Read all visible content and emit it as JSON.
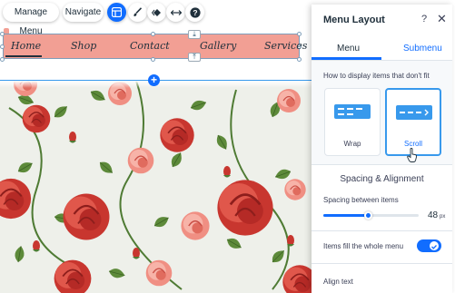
{
  "toolbar": {
    "manage_menu": "Manage Menu",
    "navigate": "Navigate",
    "icons": [
      "layout-icon",
      "paint-brush-icon",
      "animation-icon",
      "stretch-icon",
      "help-icon"
    ]
  },
  "site_menu": {
    "items": [
      {
        "label": "Home",
        "active": true
      },
      {
        "label": "Shop"
      },
      {
        "label": "Contact"
      },
      {
        "label": "Gallery"
      },
      {
        "label": "Services"
      }
    ],
    "background_color": "#f29f94"
  },
  "panel": {
    "title": "Menu Layout",
    "tabs": [
      {
        "label": "Menu",
        "selected": true
      },
      {
        "label": "Submenu"
      }
    ],
    "overflow": {
      "label": "How to display items that don't fit",
      "options": [
        {
          "label": "Wrap"
        },
        {
          "label": "Scroll",
          "selected": true
        }
      ]
    },
    "spacing": {
      "heading": "Spacing & Alignment",
      "label": "Spacing between items",
      "value": "48",
      "unit": "px",
      "slider_fraction": 0.48
    },
    "fill": {
      "label": "Items fill the whole menu",
      "enabled": true
    },
    "align": {
      "label": "Align text"
    }
  },
  "colors": {
    "accent": "#116dff",
    "menu_pink": "#f29f94",
    "rose_red": "#d9473f",
    "leaf_green": "#4f7b34"
  }
}
